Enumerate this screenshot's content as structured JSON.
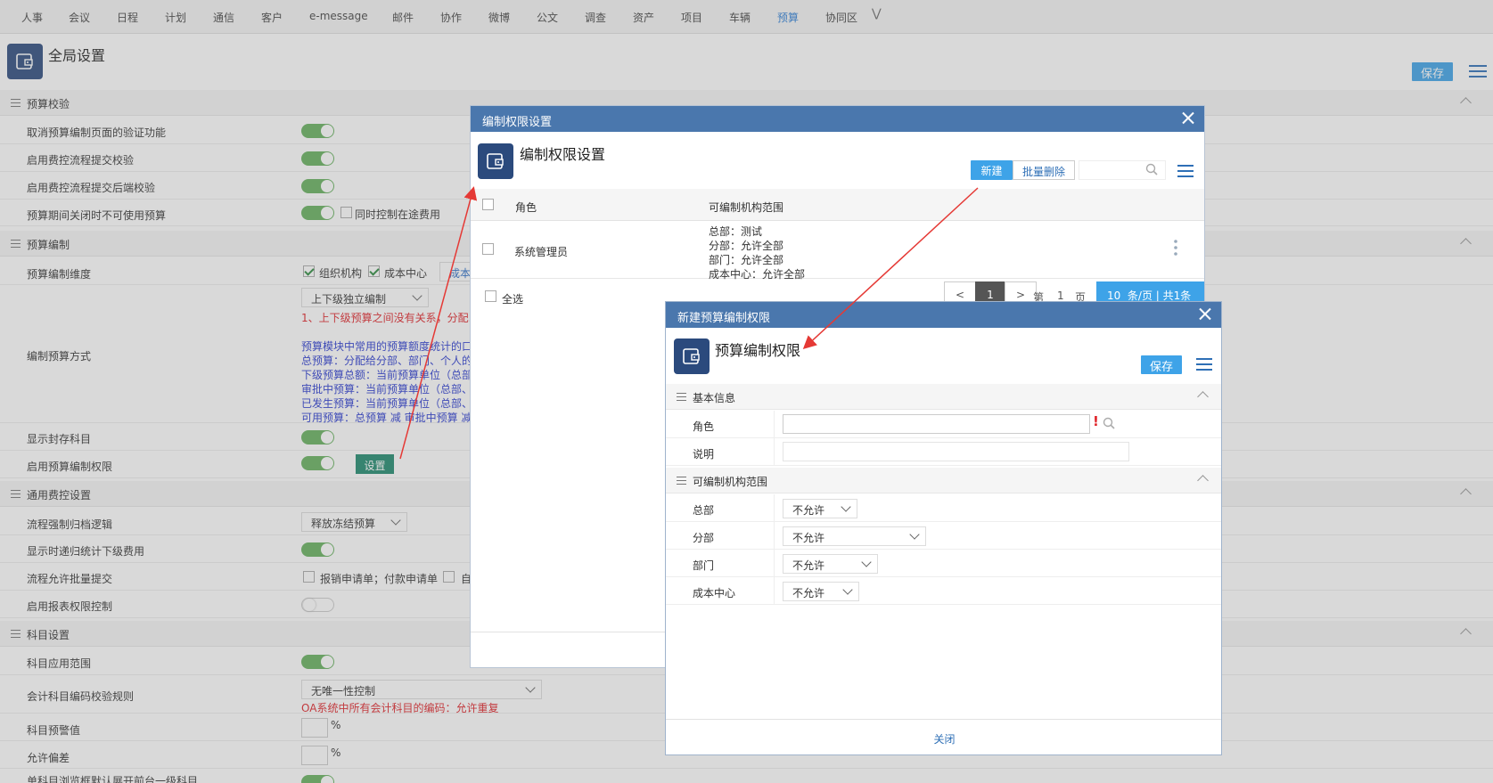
{
  "topnav": {
    "items": [
      "人事",
      "会议",
      "日程",
      "计划",
      "通信",
      "客户",
      "e-message",
      "邮件",
      "协作",
      "微博",
      "公文",
      "调查",
      "资产",
      "项目",
      "车辆",
      "预算",
      "协同区"
    ],
    "active": "预算"
  },
  "page": {
    "title": "全局设置",
    "save_label": "保存"
  },
  "sections": {
    "s1": "预算校验",
    "s2": "预算编制",
    "s3": "通用费控设置",
    "s4": "科目设置"
  },
  "rows": {
    "r1": "取消预算编制页面的验证功能",
    "r2": "启用费控流程提交校验",
    "r3": "启用费控流程提交后端校验",
    "r4": "预算期间关闭时不可使用预算",
    "r4_opt": "同时控制在途费用",
    "r5": "预算编制维度",
    "r5_opt1": "组织机构",
    "r5_opt2": "成本中心",
    "r5_opt3": "成本",
    "r6": "编制预算方式",
    "r6_select": "上下级独立编制",
    "r6_note_red": "1、上下级预算之间没有关系，分配...",
    "r6_blue": [
      "预算模块中常用的预算额度统计的口...",
      "总预算：分配给分部、部门、个人的...",
      "下级预算总额：当前预算单位（总部...",
      "审批中预算：当前预算单位（总部、...",
      "已发生预算：当前预算单位（总部、...",
      "可用预算：总预算 减 审批中预算 减..."
    ],
    "r7": "显示封存科目",
    "r8": "启用预算编制权限",
    "r8_btn": "设置",
    "r9": "流程强制归档逻辑",
    "r9_select": "释放冻结预算",
    "r10": "显示时递归统计下级费用",
    "r11": "流程允许批量提交",
    "r11_opt": "报销申请单；付款申请单",
    "r11_opt2": "自",
    "r12": "启用报表权限控制",
    "r13": "科目应用范围",
    "r14": "会计科目编码校验规则",
    "r14_select": "无唯一性控制",
    "r14_note": "OA系统中所有会计科目的编码：允许重复",
    "r15": "科目预警值",
    "r15_unit": "%",
    "r16": "允许偏差",
    "r16_unit": "%",
    "r17": "单科目浏览框默认展开前台一级科目"
  },
  "dialog1": {
    "title": "编制权限设置",
    "heading": "编制权限设置",
    "new_label": "新建",
    "batch_delete_label": "批量删除",
    "col_role": "角色",
    "col_scope": "可编制机构范围",
    "row_role": "系统管理员",
    "row_scope": [
      "总部：测试",
      "分部：允许全部",
      "部门：允许全部",
      "成本中心：允许全部"
    ],
    "select_all": "全选",
    "pager": {
      "prev": "<",
      "page": "1",
      "next": ">",
      "di": "第",
      "cur": "1",
      "ye": "页",
      "size": "10",
      "summary": "条/页 | 共1条"
    }
  },
  "dialog2": {
    "title": "新建预算编制权限",
    "heading": "预算编制权限",
    "save_label": "保存",
    "sec_basic": "基本信息",
    "role_label": "角色",
    "required_mark": "!",
    "desc_label": "说明",
    "sec_scope": "可编制机构范围",
    "hq_label": "总部",
    "hq_value": "不允许",
    "branch_label": "分部",
    "branch_value": "不允许",
    "dept_label": "部门",
    "dept_value": "不允许",
    "cc_label": "成本中心",
    "cc_value": "不允许",
    "close_label": "关闭"
  },
  "colors": {
    "accent": "#3ea3e8",
    "header_bar": "#4a77ad",
    "toggle_on": "#66b15e",
    "icon_bg": "#2b4a7d",
    "arrow": "#e53935"
  }
}
